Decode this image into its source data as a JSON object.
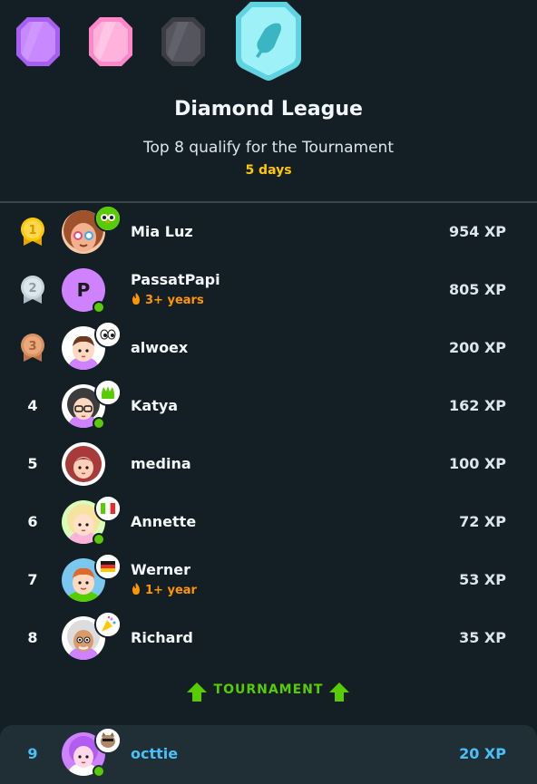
{
  "league": {
    "title": "Diamond League",
    "subtitle": "Top 8 qualify for the Tournament",
    "time_left": "5 days"
  },
  "badges": [
    {
      "name": "amethyst",
      "color": "#a560f0"
    },
    {
      "name": "pearl",
      "color": "#ff9ed2"
    },
    {
      "name": "obsidian",
      "color": "#4b4b55"
    },
    {
      "name": "diamond",
      "color": "#7ee6f0",
      "current": true
    }
  ],
  "leaderboard": [
    {
      "rank": "1",
      "name": "Mia Luz",
      "xp": "954 XP",
      "medal": "gold",
      "online": false,
      "flair": "owl"
    },
    {
      "rank": "2",
      "name": "PassatPapi",
      "xp": "805 XP",
      "medal": "silver",
      "online": true,
      "streak": "3+ years",
      "avatar_letter": "P"
    },
    {
      "rank": "3",
      "name": "alwoex",
      "xp": "200 XP",
      "medal": "bronze",
      "online": false,
      "flair": "eyes"
    },
    {
      "rank": "4",
      "name": "Katya",
      "xp": "162 XP",
      "online": true,
      "flair": "crown"
    },
    {
      "rank": "5",
      "name": "medina",
      "xp": "100 XP",
      "online": false
    },
    {
      "rank": "6",
      "name": "Annette",
      "xp": "72 XP",
      "online": true,
      "flair": "italy-flag"
    },
    {
      "rank": "7",
      "name": "Werner",
      "xp": "53 XP",
      "online": false,
      "streak": "1+ year",
      "flair": "germany-flag"
    },
    {
      "rank": "8",
      "name": "Richard",
      "xp": "35 XP",
      "online": false,
      "flair": "party"
    }
  ],
  "promotion_label": "TOURNAMENT",
  "current_user": {
    "rank": "9",
    "name": "octtie",
    "xp": "20 XP",
    "online": true,
    "flair": "cat"
  },
  "colors": {
    "background": "#131f24",
    "highlight_row": "#202f36",
    "gold": "#ffc800",
    "green": "#58cc02",
    "blue": "#49c0f8",
    "streak_orange": "#ff9600"
  }
}
